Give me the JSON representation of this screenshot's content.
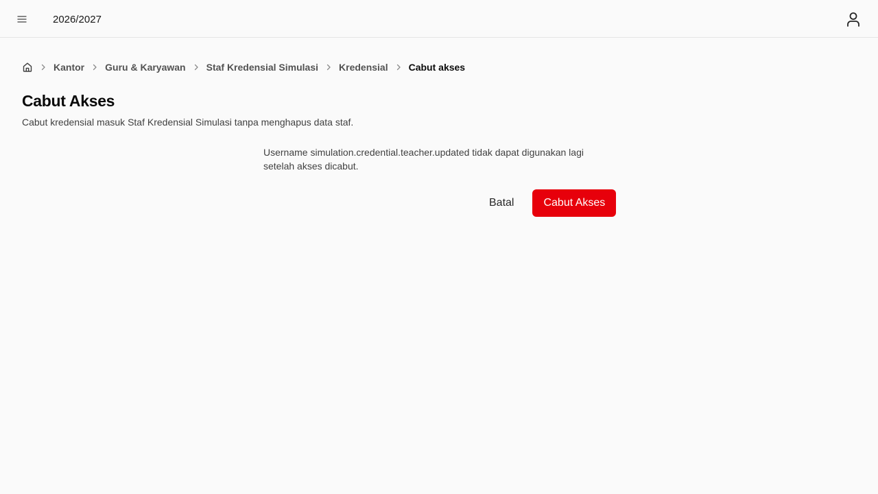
{
  "header": {
    "menu_icon": "hamburger-icon",
    "academic_year": "2026/2027",
    "user_icon": "user-icon"
  },
  "breadcrumb": {
    "home_icon": "home-icon",
    "separator_icon": "chevron-right-icon",
    "items": [
      "Kantor",
      "Guru & Karyawan",
      "Staf Kredensial Simulasi",
      "Kredensial"
    ],
    "current": "Cabut akses"
  },
  "page": {
    "title": "Cabut Akses",
    "subtitle": "Cabut kredensial masuk Staf Kredensial Simulasi tanpa menghapus data staf."
  },
  "confirm": {
    "message": "Username simulation.credential.teacher.updated tidak dapat digunakan lagi setelah akses dicabut.",
    "cancel_label": "Batal",
    "revoke_label": "Cabut Akses"
  },
  "colors": {
    "danger": "#e7000b",
    "background": "#fafafa",
    "border": "#e5e5e5"
  }
}
